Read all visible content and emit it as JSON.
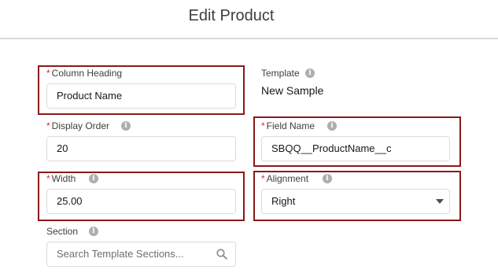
{
  "modal": {
    "title": "Edit Product"
  },
  "fields": {
    "column_heading": {
      "label": "Column Heading",
      "required": "*",
      "value": "Product Name"
    },
    "template": {
      "label": "Template",
      "value": "New Sample"
    },
    "display_order": {
      "label": "Display Order",
      "required": "*",
      "value": "20"
    },
    "field_name": {
      "label": "Field Name",
      "required": "*",
      "value": "SBQQ__ProductName__c"
    },
    "width": {
      "label": "Width",
      "required": "*",
      "value": "25.00"
    },
    "alignment": {
      "label": "Alignment",
      "required": "*",
      "value": "Right"
    },
    "section": {
      "label": "Section",
      "placeholder": "Search Template Sections..."
    }
  },
  "icons": {
    "info": "info-icon",
    "search": "search-icon",
    "dropdown": "chevron-down-icon"
  },
  "colors": {
    "highlight": "#8b1a1a",
    "required": "#c23934",
    "border": "#dddbda"
  }
}
